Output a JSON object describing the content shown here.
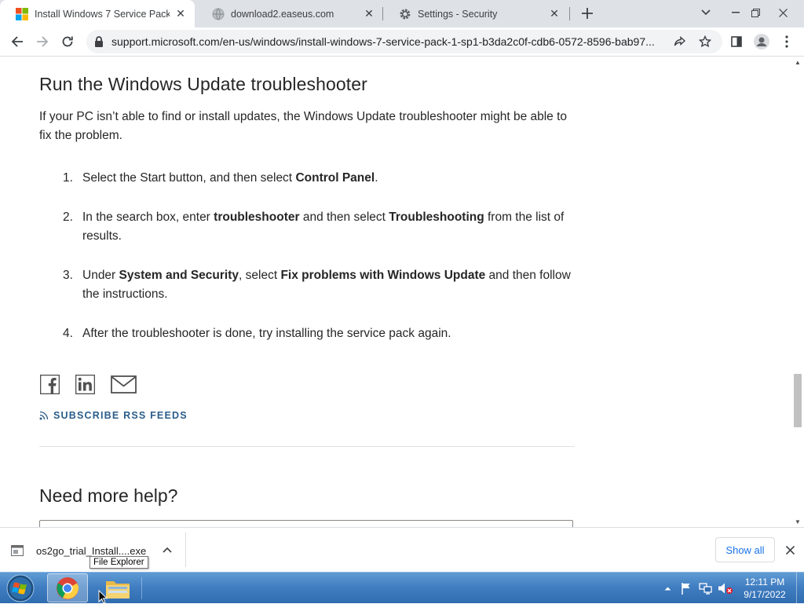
{
  "tabs": [
    {
      "title": "Install Windows 7 Service Pack 1",
      "favicon": "windows-logo-icon",
      "active": true
    },
    {
      "title": "download2.easeus.com",
      "favicon": "globe-icon",
      "active": false
    },
    {
      "title": "Settings - Security",
      "favicon": "gear-icon",
      "active": false
    }
  ],
  "toolbar": {
    "url": "support.microsoft.com/en-us/windows/install-windows-7-service-pack-1-sp1-b3da2c0f-cdb6-0572-8596-bab97..."
  },
  "article": {
    "heading": "Run the Windows Update troubleshooter",
    "intro": "If your PC isn’t able to find or install updates, the Windows Update troubleshooter might be able to fix the problem.",
    "steps": [
      {
        "num": "1.",
        "parts": [
          {
            "t": "Select the Start button, and then select ",
            "b": false
          },
          {
            "t": "Control Panel",
            "b": true
          },
          {
            "t": ".",
            "b": false
          }
        ]
      },
      {
        "num": "2.",
        "parts": [
          {
            "t": "In the search box, enter ",
            "b": false
          },
          {
            "t": "troubleshooter",
            "b": true
          },
          {
            "t": " and then select ",
            "b": false
          },
          {
            "t": "Troubleshooting",
            "b": true
          },
          {
            "t": " from the list of results.",
            "b": false
          }
        ]
      },
      {
        "num": "3.",
        "parts": [
          {
            "t": "Under ",
            "b": false
          },
          {
            "t": "System and Security",
            "b": true
          },
          {
            "t": ", select ",
            "b": false
          },
          {
            "t": "Fix problems with Windows Update",
            "b": true
          },
          {
            "t": " and then follow the instructions.",
            "b": false
          }
        ]
      },
      {
        "num": "4.",
        "parts": [
          {
            "t": "After the troubleshooter is done, try installing the service pack again.",
            "b": false
          }
        ]
      }
    ],
    "share_icons": [
      "facebook-icon",
      "linkedin-icon",
      "email-icon"
    ],
    "rss_label": "SUBSCRIBE RSS FEEDS",
    "help_heading": "Need more help?"
  },
  "downloads": {
    "file": "os2go_trial_Install....exe",
    "show_all": "Show all",
    "tooltip": "File Explorer"
  },
  "taskbar": {
    "time": "12:11 PM",
    "date": "9/17/2022"
  },
  "colors": {
    "tabstrip": "#dee1e6",
    "link_blue": "#1a73e8",
    "rss_blue": "#2b5d8a",
    "taskbar": "#3f7cc0"
  }
}
